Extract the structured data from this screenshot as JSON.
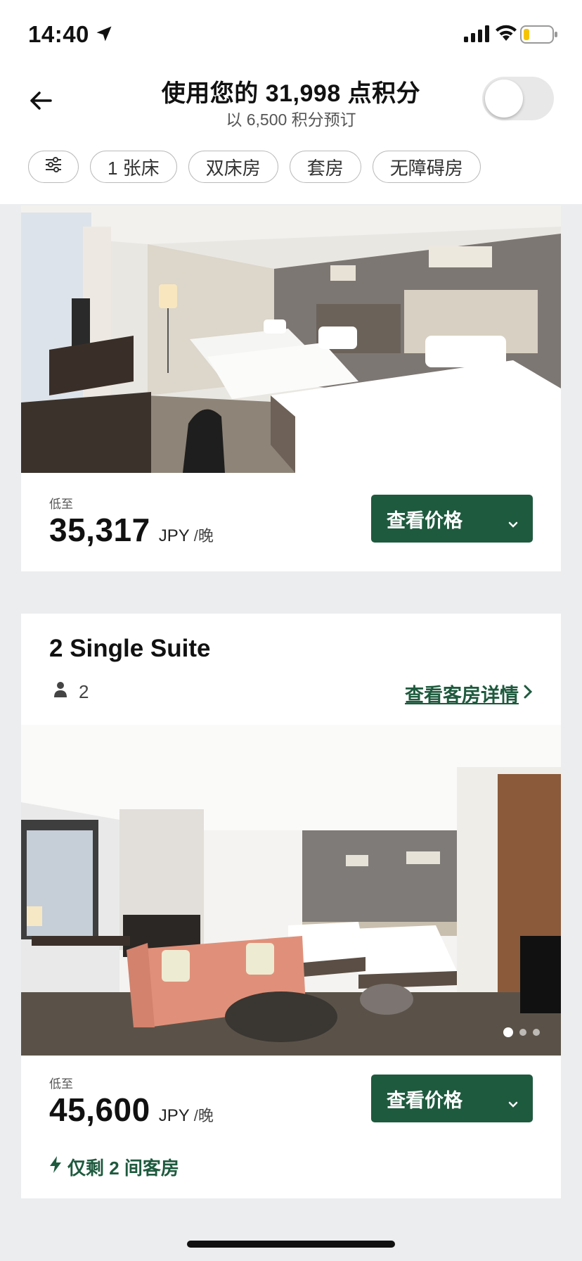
{
  "status_bar": {
    "time": "14:40"
  },
  "header": {
    "title": "使用您的 31,998 点积分",
    "subtitle": "以 6,500 积分预订",
    "points_toggle_on": false
  },
  "filters": {
    "chips": [
      "1 张床",
      "双床房",
      "套房",
      "无障碍房"
    ]
  },
  "rooms": [
    {
      "from_label": "低至",
      "price": "35,317",
      "currency": "JPY",
      "per": "/晚",
      "button_label": "查看价格",
      "photo_count": 3,
      "photo_active": 1
    },
    {
      "name": "2 Single Suite",
      "guests": "2",
      "details_link": "查看客房详情",
      "from_label": "低至",
      "price": "45,600",
      "currency": "JPY",
      "per": "/晚",
      "button_label": "查看价格",
      "availability": "仅剩 2 间客房",
      "photo_count": 3,
      "photo_active": 1
    }
  ],
  "colors": {
    "accent_green": "#1E5A3E",
    "page_bg": "#ECEDEF"
  }
}
